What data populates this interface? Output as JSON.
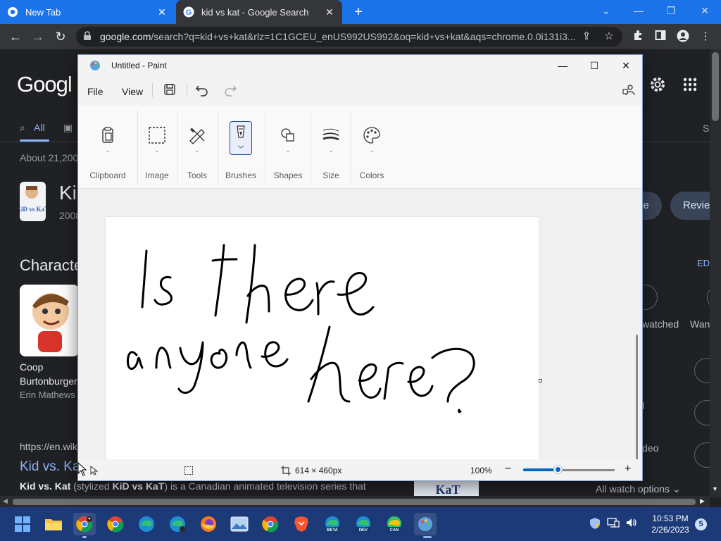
{
  "browser": {
    "tabs": [
      {
        "title": "New Tab",
        "active": false
      },
      {
        "title": "kid vs kat - Google Search",
        "active": true
      }
    ],
    "url_domain": "google.com",
    "url_rest": "/search?q=kid+vs+kat&rlz=1C1GCEU_enUS992US992&oq=kid+vs+kat&aqs=chrome.0.0i131i3..."
  },
  "google": {
    "logo": "Googl",
    "tab_all": "All",
    "results_count": "About 21,200",
    "kp_title": "Ki",
    "kp_sub": "2008",
    "pill_1": "le",
    "pill_2": "Revie",
    "characters_heading": "Characte",
    "edit_link": "ED",
    "char_first": "Coop",
    "char_last": "Burtonburger",
    "char_actor": "Erin Mathews",
    "watched": "watched",
    "want": "Wan",
    "side_l": "l",
    "side_video": "deo",
    "result_url": "https://en.wik",
    "result_title": "Kid vs. Ka",
    "result_snippet_b1": "Kid vs. Kat",
    "result_snippet_p1": " (stylized ",
    "result_snippet_b2": "KiD vs KaT",
    "result_snippet_p2": ") is a Canadian animated television series that",
    "all_watch_options": "All watch options",
    "partial_s": "S",
    "thumb_logo": "KiD vs KaT"
  },
  "paint": {
    "title": "Untitled - Paint",
    "menu": {
      "file": "File",
      "view": "View"
    },
    "groups": [
      "Clipboard",
      "Image",
      "Tools",
      "Brushes",
      "Shapes",
      "Size",
      "Colors"
    ],
    "status": {
      "dimensions": "614 × 460px",
      "zoom": "100%"
    },
    "zoom_level": 0.38,
    "handwriting": [
      "Is there",
      "anyone",
      "here?"
    ]
  },
  "taskbar": {
    "time": "10:53 PM",
    "date": "2/26/2023",
    "notifications": "5",
    "beta": "BETA",
    "dev": "DEV",
    "can": "CAN"
  },
  "colors": {
    "chrome_accent": "#1a73e8",
    "google_bg": "#202124",
    "link": "#8ab4f8",
    "taskbar": "#1c3a78",
    "paint_zoom": "#0067c0"
  }
}
